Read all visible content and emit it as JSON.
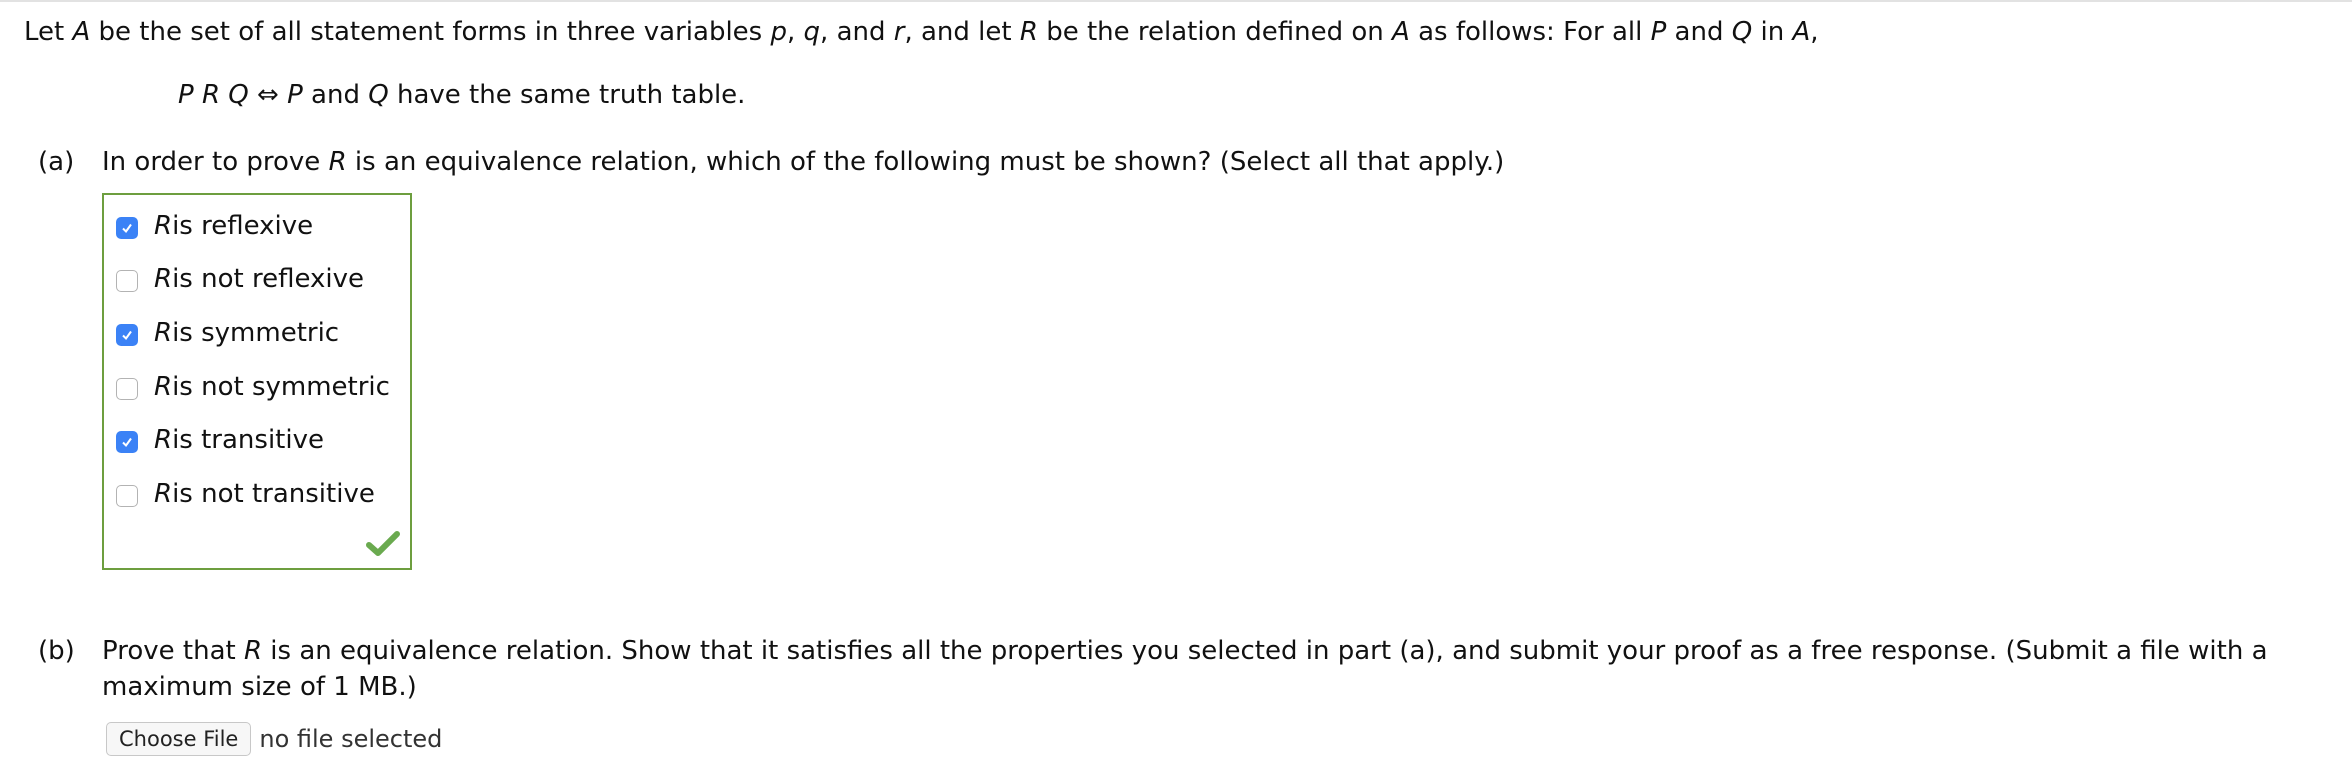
{
  "intro": {
    "t1": "Let ",
    "A": "A",
    "t2": " be the set of all statement forms in three variables ",
    "p": "p",
    "c1": ", ",
    "q": "q",
    "t3": ", and ",
    "r": "r",
    "t4": ", and let ",
    "R": "R",
    "t5": " be the relation defined on ",
    "A2": "A",
    "t6": " as follows: For all ",
    "P": "P",
    "t7": " and ",
    "Q": "Q",
    "t8": " in ",
    "A3": "A",
    "t9": ","
  },
  "definition": {
    "P": "P",
    "R": "R",
    "Q": "Q",
    "iff": "⇔",
    "P2": "P",
    "and": " and ",
    "Q2": "Q",
    "rest": " have the same truth table."
  },
  "part_a": {
    "label": "(a)",
    "q1": "In order to prove ",
    "R": "R",
    "q2": " is an equivalence relation, which of the following must be shown? (Select all that apply.)",
    "options": [
      {
        "var": "R",
        "text": " is reflexive",
        "checked": true
      },
      {
        "var": "R",
        "text": " is not reflexive",
        "checked": false
      },
      {
        "var": "R",
        "text": " is symmetric",
        "checked": true
      },
      {
        "var": "R",
        "text": " is not symmetric",
        "checked": false
      },
      {
        "var": "R",
        "text": " is transitive",
        "checked": true
      },
      {
        "var": "R",
        "text": " is not transitive",
        "checked": false
      }
    ],
    "status": "correct",
    "accent_color": "#3b82f6",
    "correct_color": "#6d9e3f"
  },
  "part_b": {
    "label": "(b)",
    "t1": "Prove that ",
    "R": "R",
    "t2": " is an equivalence relation. Show that it satisfies all the properties you selected in part (a), and submit your proof as a free response. (Submit a file with a maximum size of 1 MB.)",
    "file_button": "Choose File",
    "file_status": "no file selected"
  }
}
